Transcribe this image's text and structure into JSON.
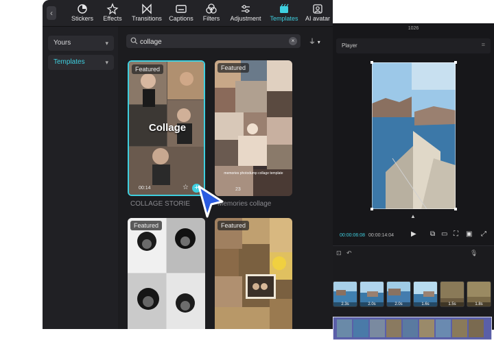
{
  "toolbar": {
    "items": [
      {
        "label": "Stickers",
        "icon": "sticker-icon"
      },
      {
        "label": "Effects",
        "icon": "effects-icon"
      },
      {
        "label": "Transitions",
        "icon": "transitions-icon"
      },
      {
        "label": "Captions",
        "icon": "captions-icon"
      },
      {
        "label": "Filters",
        "icon": "filters-icon"
      },
      {
        "label": "Adjustment",
        "icon": "adjustment-icon"
      },
      {
        "label": "Templates",
        "icon": "templates-icon",
        "active": true
      },
      {
        "label": "AI avatar",
        "icon": "ai-avatar-icon"
      }
    ],
    "accent": "#3fd0e0"
  },
  "sidebar": {
    "items": [
      {
        "label": "Yours"
      },
      {
        "label": "Templates",
        "active": true
      }
    ]
  },
  "search": {
    "value": "collage"
  },
  "templates": [
    {
      "badge": "Featured",
      "title": "COLLAGE STORIE",
      "overlay_text": "Collage",
      "meta": "00:14"
    },
    {
      "badge": "Featured",
      "title": "Memories collage",
      "caption": "memories photodump collage template",
      "meta": "23"
    },
    {
      "badge": "Featured",
      "title": ""
    },
    {
      "badge": "Featured",
      "title": ""
    }
  ],
  "player": {
    "window_title": "1026",
    "label": "Player",
    "current_time": "00:00:06:08",
    "total_time": "00:00:14:04"
  },
  "timeline": {
    "clips": [
      {
        "duration": "2.3s"
      },
      {
        "duration": "2.0s"
      },
      {
        "duration": "2.0s"
      },
      {
        "duration": "1.6s"
      },
      {
        "duration": "1.5s"
      },
      {
        "duration": "1.8s"
      }
    ]
  }
}
